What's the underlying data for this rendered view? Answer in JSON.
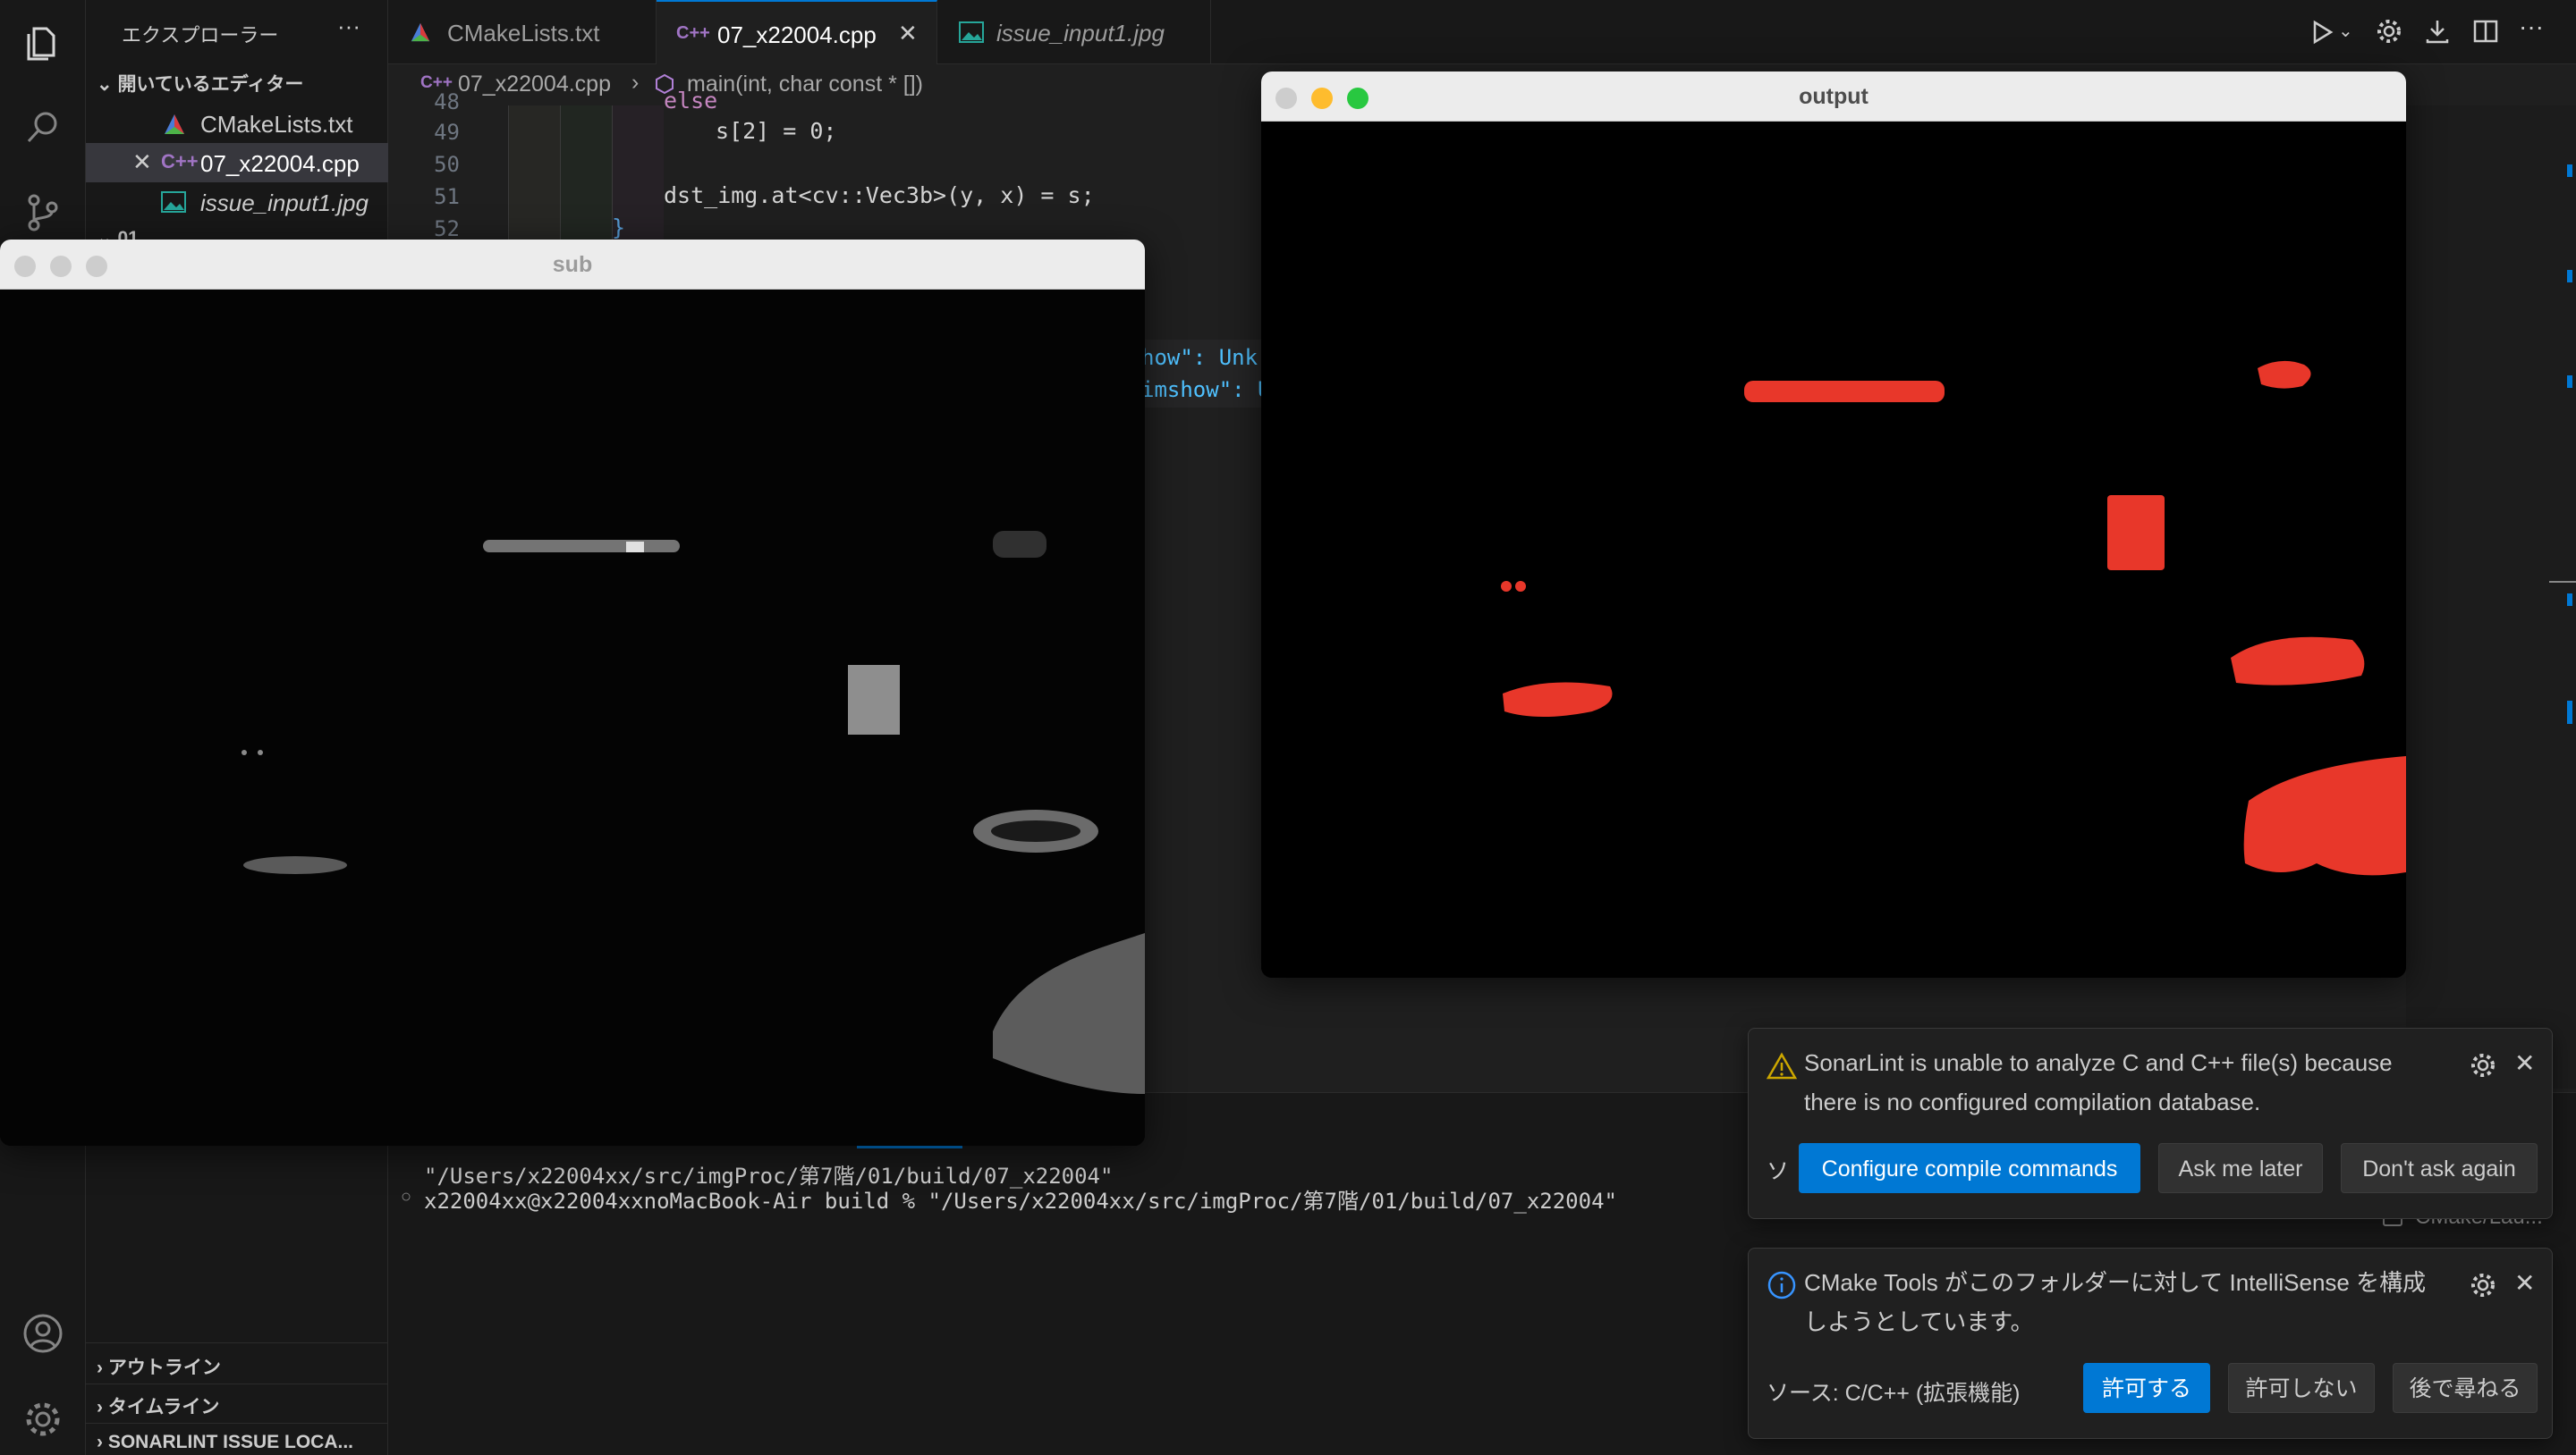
{
  "explorer": {
    "title": "エクスプローラー",
    "more": "···",
    "open_editors_header": "開いているエディター",
    "open_editors": [
      {
        "name": "CMakeLists.txt",
        "icon": "cmake-icon"
      },
      {
        "name": "07_x22004.cpp",
        "icon": "cpp-icon"
      },
      {
        "name": "issue_input1.jpg",
        "icon": "image-icon"
      }
    ],
    "folder_partial": "01",
    "outline": "アウトライン",
    "timeline": "タイムライン",
    "sonarlint": "SONARLINT ISSUE LOCA..."
  },
  "tabs": [
    {
      "label": "CMakeLists.txt"
    },
    {
      "label": "07_x22004.cpp"
    },
    {
      "label": "issue_input1.jpg"
    }
  ],
  "breadcrumbs": {
    "file": "07_x22004.cpp",
    "symbol": "main(int, char const * [])"
  },
  "editor": {
    "lines": [
      {
        "num": "48",
        "text": "else"
      },
      {
        "num": "49",
        "text": "s[2] = 0;"
      },
      {
        "num": "50",
        "text": ""
      },
      {
        "num": "51",
        "text": "dst_img.at<cv::Vec3b>(y, x) = s;"
      },
      {
        "num": "52",
        "text": "}"
      }
    ],
    "hover_line_1": "how\": Unk",
    "hover_line_2": "imshow\": U"
  },
  "windows": {
    "sub_title": "sub",
    "output_title": "output"
  },
  "terminal": {
    "line1": "\"/Users/x22004xx/src/imgProc/第7階/01/build/07_x22004\"",
    "line2": "x22004xx@x22004xxnoMacBook-Air build % \"/Users/x22004xx/src/imgProc/第7階/01/build/07_x22004\""
  },
  "notifications": [
    {
      "icon": "warning-icon",
      "line1": "SonarLint is unable to analyze C and C++ file(s) because",
      "line2": "there is no configured compilation database.",
      "source": "ソ",
      "buttons": [
        "Configure compile commands",
        "Ask me later",
        "Don't ask again"
      ]
    },
    {
      "icon": "info-icon",
      "line1": "CMake Tools がこのフォルダーに対して IntelliSense を構成",
      "line2": "しようとしています。",
      "source": "ソース: C/C++ (拡張機能)",
      "buttons": [
        "許可する",
        "許可しない",
        "後で尋ねる"
      ]
    }
  ],
  "bg_partial": {
    "cmake_tail": "CMake/Lau..."
  },
  "colors": {
    "accent": "#0078d4",
    "blob_red": "#e8372a"
  }
}
